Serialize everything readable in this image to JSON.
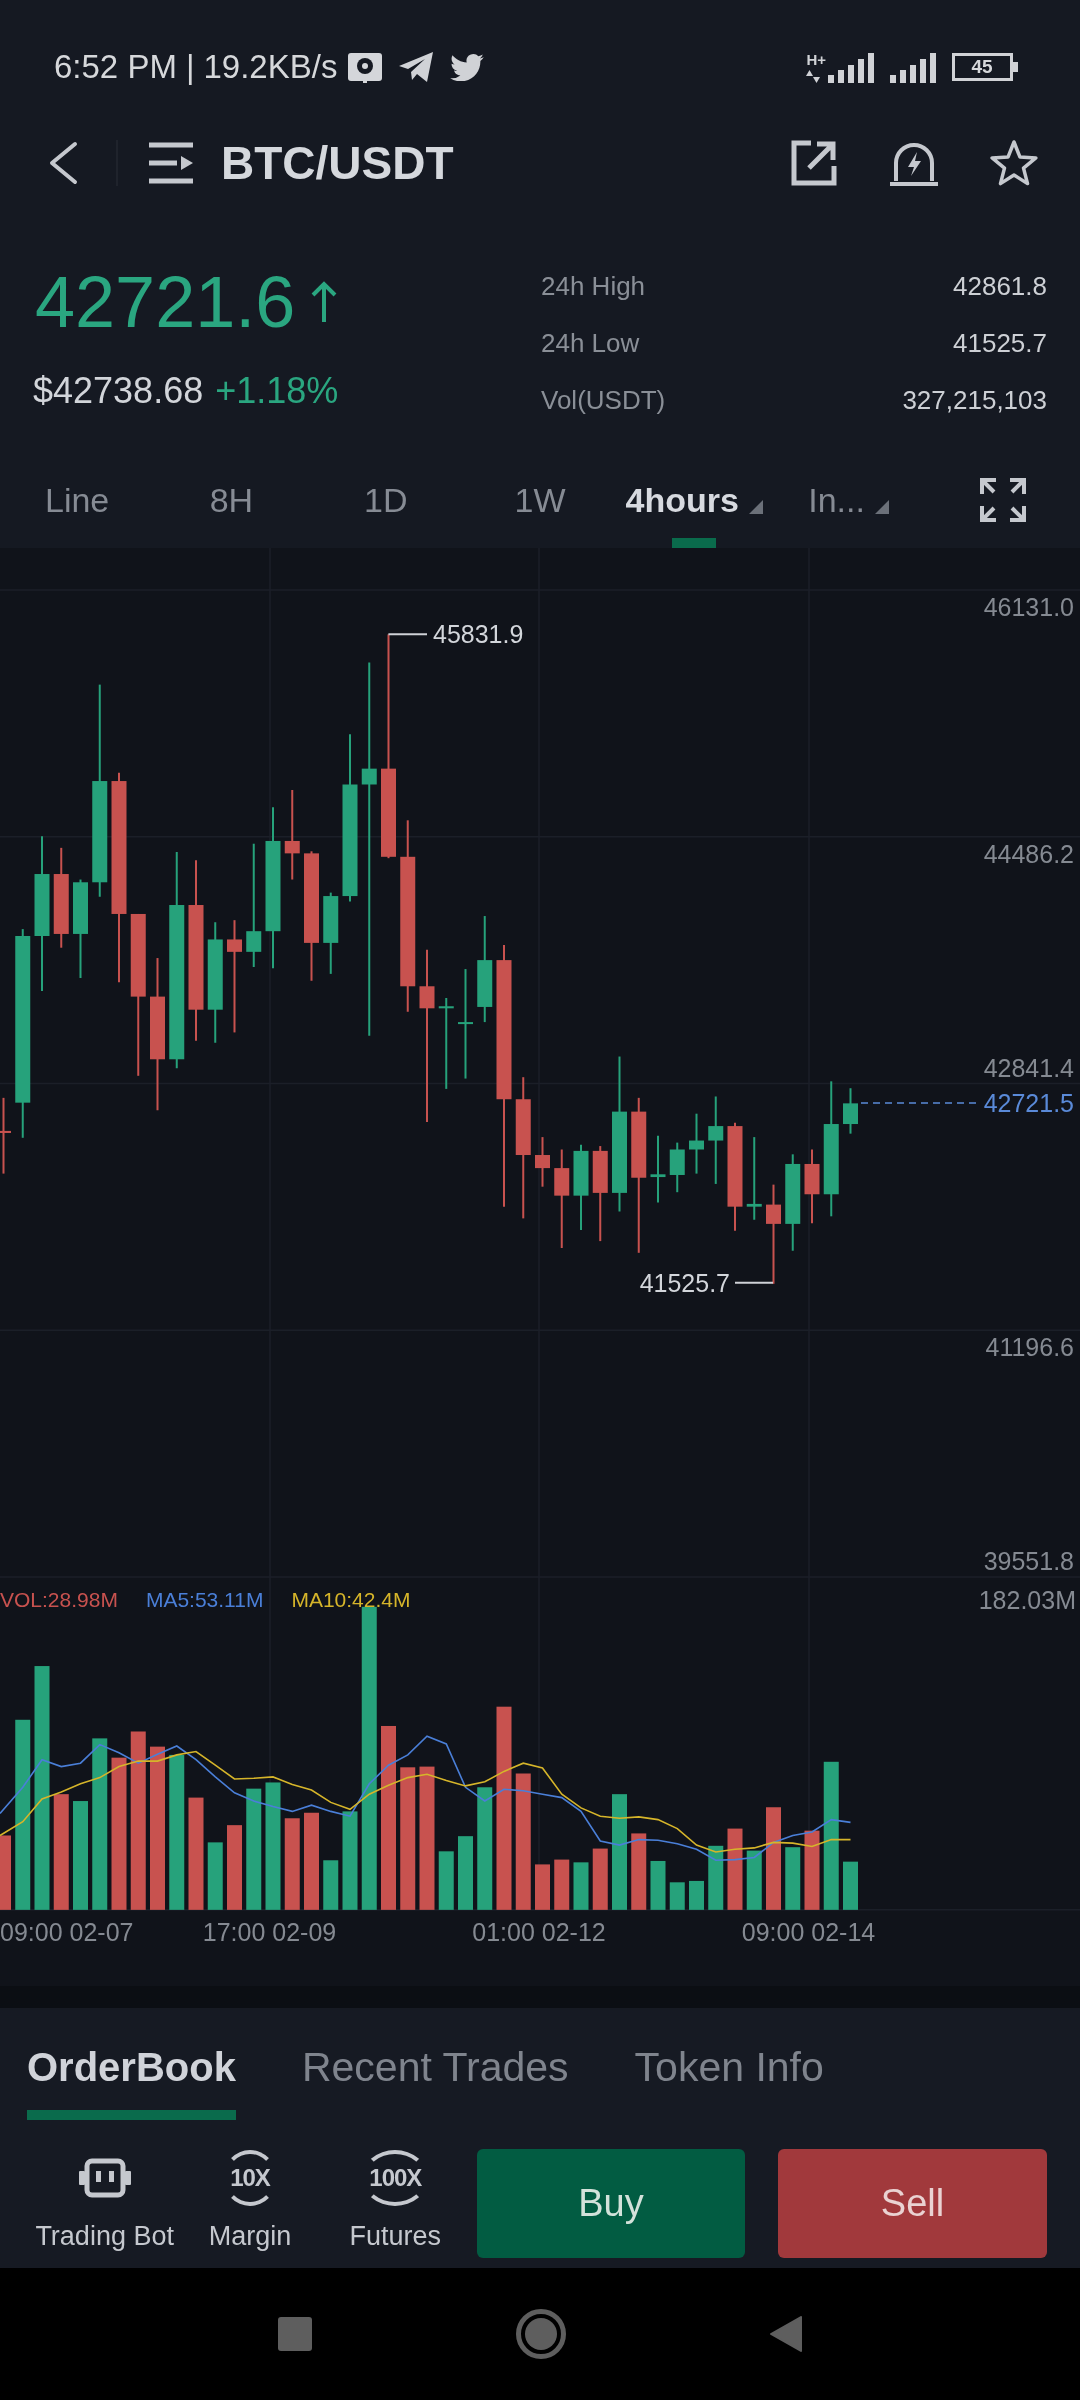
{
  "status_bar": {
    "time": "6:52 PM",
    "separator": "|",
    "net_speed": "19.2KB/s",
    "network_type": "H+",
    "battery": "45"
  },
  "header": {
    "title": "BTC/USDT",
    "favorite": false
  },
  "ticker": {
    "price": "42721.6",
    "price_up": true,
    "usd_price": "$42738.68",
    "change": "+1.18%",
    "stats": [
      {
        "label": "24h High",
        "value": "42861.8"
      },
      {
        "label": "24h Low",
        "value": "41525.7"
      },
      {
        "label": "Vol(USDT)",
        "value": "327,215,103"
      }
    ]
  },
  "timeframes": [
    {
      "label": "Line",
      "selected": false,
      "dropdown": false
    },
    {
      "label": "8H",
      "selected": false,
      "dropdown": false
    },
    {
      "label": "1D",
      "selected": false,
      "dropdown": false
    },
    {
      "label": "1W",
      "selected": false,
      "dropdown": false
    },
    {
      "label": "4hours",
      "selected": true,
      "dropdown": true
    },
    {
      "label": "In...",
      "selected": false,
      "dropdown": true
    }
  ],
  "chart": {
    "price_axis": [
      "46131.0",
      "44486.2",
      "42841.4",
      "41196.6",
      "39551.8"
    ],
    "high_marker": "45831.9",
    "low_marker": "41525.7",
    "last_price": "42721.5",
    "volume_legend": [
      {
        "text": "VOL:28.98M",
        "color": "#c8524f"
      },
      {
        "text": "MA5:53.11M",
        "color": "#4a7fd8"
      },
      {
        "text": "MA10:42.4M",
        "color": "#d6b52a"
      }
    ],
    "volume_axis": "182.03M",
    "time_axis": [
      "09:00 02-07",
      "17:00 02-09",
      "01:00 02-12",
      "09:00 02-14"
    ]
  },
  "bottom_tabs": [
    {
      "label": "OrderBook",
      "selected": true
    },
    {
      "label": "Recent Trades",
      "selected": false
    },
    {
      "label": "Token Info",
      "selected": false
    }
  ],
  "actions": [
    {
      "kind": "bot",
      "label": "Trading Bot"
    },
    {
      "kind": "leverage",
      "badge": "10X",
      "label": "Margin"
    },
    {
      "kind": "leverage",
      "badge": "100X",
      "label": "Futures"
    }
  ],
  "trade_buttons": [
    {
      "kind": "buy",
      "label": "Buy"
    },
    {
      "kind": "sell",
      "label": "Sell"
    }
  ]
}
